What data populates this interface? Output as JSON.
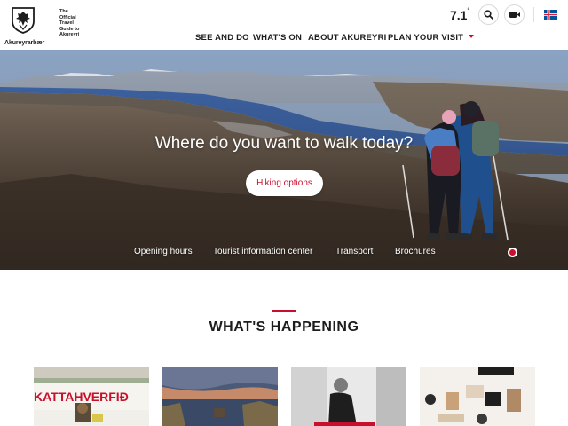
{
  "header": {
    "logo_caption": "Akureyrarbær",
    "tagline": [
      "The",
      "Official",
      "Travel",
      "Guide to",
      "Akureyri"
    ],
    "nav": [
      {
        "label": "SEE AND DO"
      },
      {
        "label": "WHAT'S ON"
      },
      {
        "label": "ABOUT AKUREYRI"
      },
      {
        "label": "PLAN YOUR VISIT"
      }
    ],
    "temperature": "7.1",
    "temperature_unit": "°",
    "icons": {
      "search": "search-icon",
      "video": "video-camera-icon",
      "language": "iceland-flag-icon"
    }
  },
  "hero": {
    "title": "Where do you want to walk today?",
    "button": "Hiking options",
    "links": [
      "Opening hours",
      "Tourist information center",
      "Transport",
      "Brochures"
    ]
  },
  "section": {
    "title": "WHAT'S HAPPENING",
    "cards": [
      {
        "name": "event-card-1",
        "text": "KATTAHVERFIÐ"
      },
      {
        "name": "event-card-2",
        "text": ""
      },
      {
        "name": "event-card-3",
        "text": ""
      },
      {
        "name": "event-card-4",
        "text": ""
      }
    ]
  },
  "colors": {
    "accent": "#c8102e",
    "text": "#1d1d1d"
  }
}
